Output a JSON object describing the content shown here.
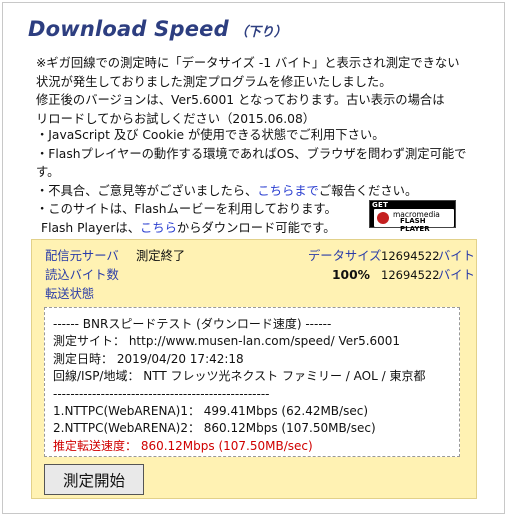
{
  "title": {
    "main": "Download Speed",
    "sub": "（下り）"
  },
  "notice": {
    "lines": [
      "※ギガ回線での測定時に「データサイズ -1 バイト」と表示され測定できない",
      "状況が発生しておりました測定プログラムを修正いたしました。",
      "修正後のバージョンは、Ver5.6001 となっております。古い表示の場合は",
      "リロードしてからお試しください（2015.06.08）"
    ]
  },
  "bullets": {
    "b1": "・JavaScript 及び Cookie が使用できる状態でご利用下さい。",
    "b2_line1": "・Flashプレイヤーの動作する環境であればOS、ブラウザを問わず測定可能で",
    "b2_line2": "す。",
    "b3_pre": "・不具合、ご意見等がございましたら、",
    "b3_link": "こちらまで",
    "b3_post": "ご報告ください。",
    "b4": "・このサイトは、Flashムービーを利用しております。",
    "b5_pre": "Flash Playerは、",
    "b5_link": "こちら",
    "b5_post": "からダウンロード可能です。"
  },
  "flash_badge": {
    "get": "GET",
    "brand": "macromedia",
    "product1": "FLASH",
    "product2": "PLAYER"
  },
  "panel": {
    "server_label": "配信元サーバ",
    "status_value": "測定終了",
    "read_bytes_label": "読込バイト数",
    "transfer_label": "転送状態",
    "data_size_label": "データサイズ",
    "data_size_value": "12694522",
    "unit_byte_1": "バイト",
    "percent": "100%",
    "read_bytes_value": "12694522",
    "unit_byte_2": "バイト"
  },
  "result": {
    "header": "------ BNRスピードテスト (ダウンロード速度) ------",
    "site": "測定サイト： http://www.musen-lan.com/speed/ Ver5.6001",
    "datetime": "測定日時： 2019/04/20 17:42:18",
    "isp": "回線/ISP/地域： NTT フレッツ光ネクスト ファミリー / AOL / 東京都",
    "divider": "--------------------------------------------------",
    "test1": "1.NTTPC(WebARENA)1： 499.41Mbps (62.42MB/sec)",
    "test2": "2.NTTPC(WebARENA)2： 860.12Mbps (107.50MB/sec)",
    "estimate": "推定転送速度： 860.12Mbps (107.50MB/sec)"
  },
  "start_button": "測定開始",
  "colors": {
    "title": "#2d3e80",
    "panel_bg": "#fff2b3",
    "label": "#2a3ca8",
    "link": "#2b3fd0",
    "estimate": "#d00000"
  }
}
